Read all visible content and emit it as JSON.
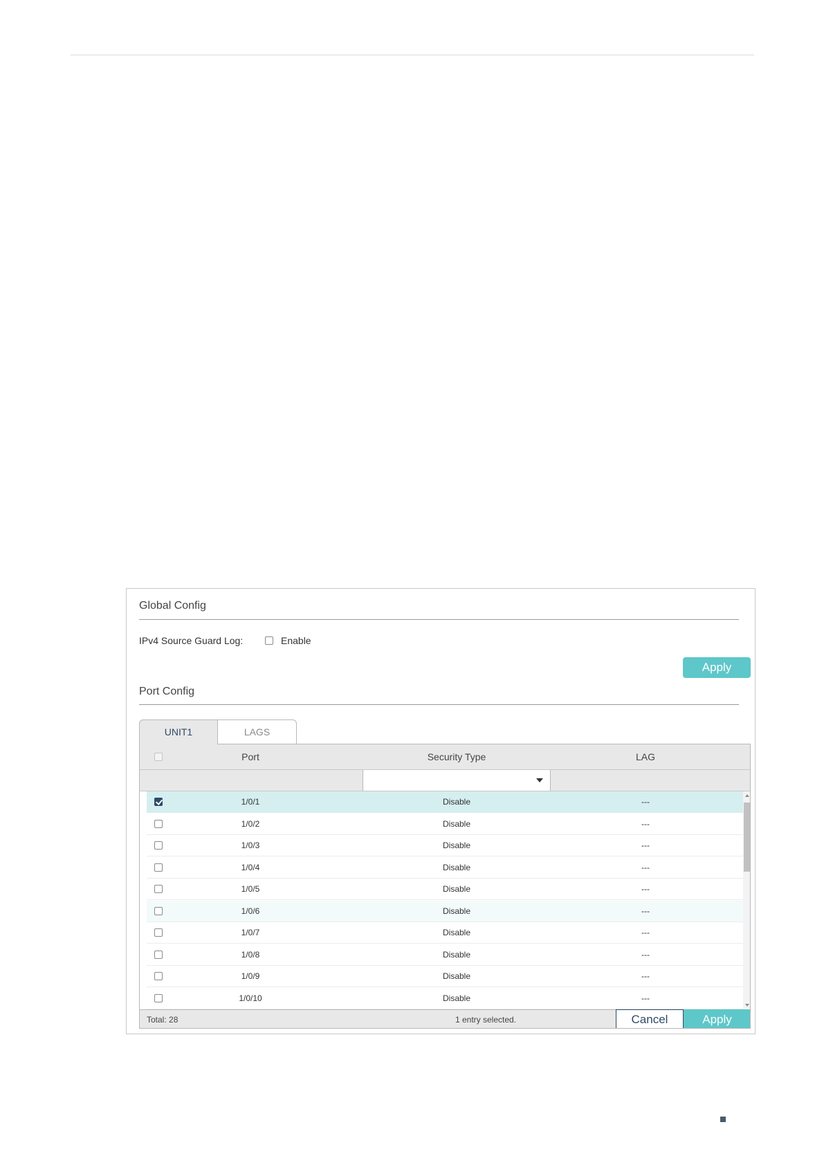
{
  "global_config": {
    "title": "Global Config",
    "log_label": "IPv4 Source Guard Log:",
    "enable_label": "Enable",
    "enable_checked": false,
    "apply_label": "Apply"
  },
  "port_config": {
    "title": "Port Config",
    "tabs": [
      {
        "label": "UNIT1",
        "active": true
      },
      {
        "label": "LAGS",
        "active": false
      }
    ],
    "columns": [
      "Port",
      "Security Type",
      "LAG"
    ],
    "rows": [
      {
        "port": "1/0/1",
        "security_type": "Disable",
        "lag": "---",
        "checked": true
      },
      {
        "port": "1/0/2",
        "security_type": "Disable",
        "lag": "---",
        "checked": false
      },
      {
        "port": "1/0/3",
        "security_type": "Disable",
        "lag": "---",
        "checked": false
      },
      {
        "port": "1/0/4",
        "security_type": "Disable",
        "lag": "---",
        "checked": false
      },
      {
        "port": "1/0/5",
        "security_type": "Disable",
        "lag": "---",
        "checked": false
      },
      {
        "port": "1/0/6",
        "security_type": "Disable",
        "lag": "---",
        "checked": false
      },
      {
        "port": "1/0/7",
        "security_type": "Disable",
        "lag": "---",
        "checked": false
      },
      {
        "port": "1/0/8",
        "security_type": "Disable",
        "lag": "---",
        "checked": false
      },
      {
        "port": "1/0/9",
        "security_type": "Disable",
        "lag": "---",
        "checked": false
      },
      {
        "port": "1/0/10",
        "security_type": "Disable",
        "lag": "---",
        "checked": false
      }
    ],
    "footer": {
      "total": "Total: 28",
      "selected": "1 entry selected.",
      "cancel_label": "Cancel",
      "apply_label": "Apply"
    }
  },
  "colors": {
    "accent": "#5ec7c9",
    "selected_row": "#d5eef0",
    "dark": "#2e4a66"
  }
}
